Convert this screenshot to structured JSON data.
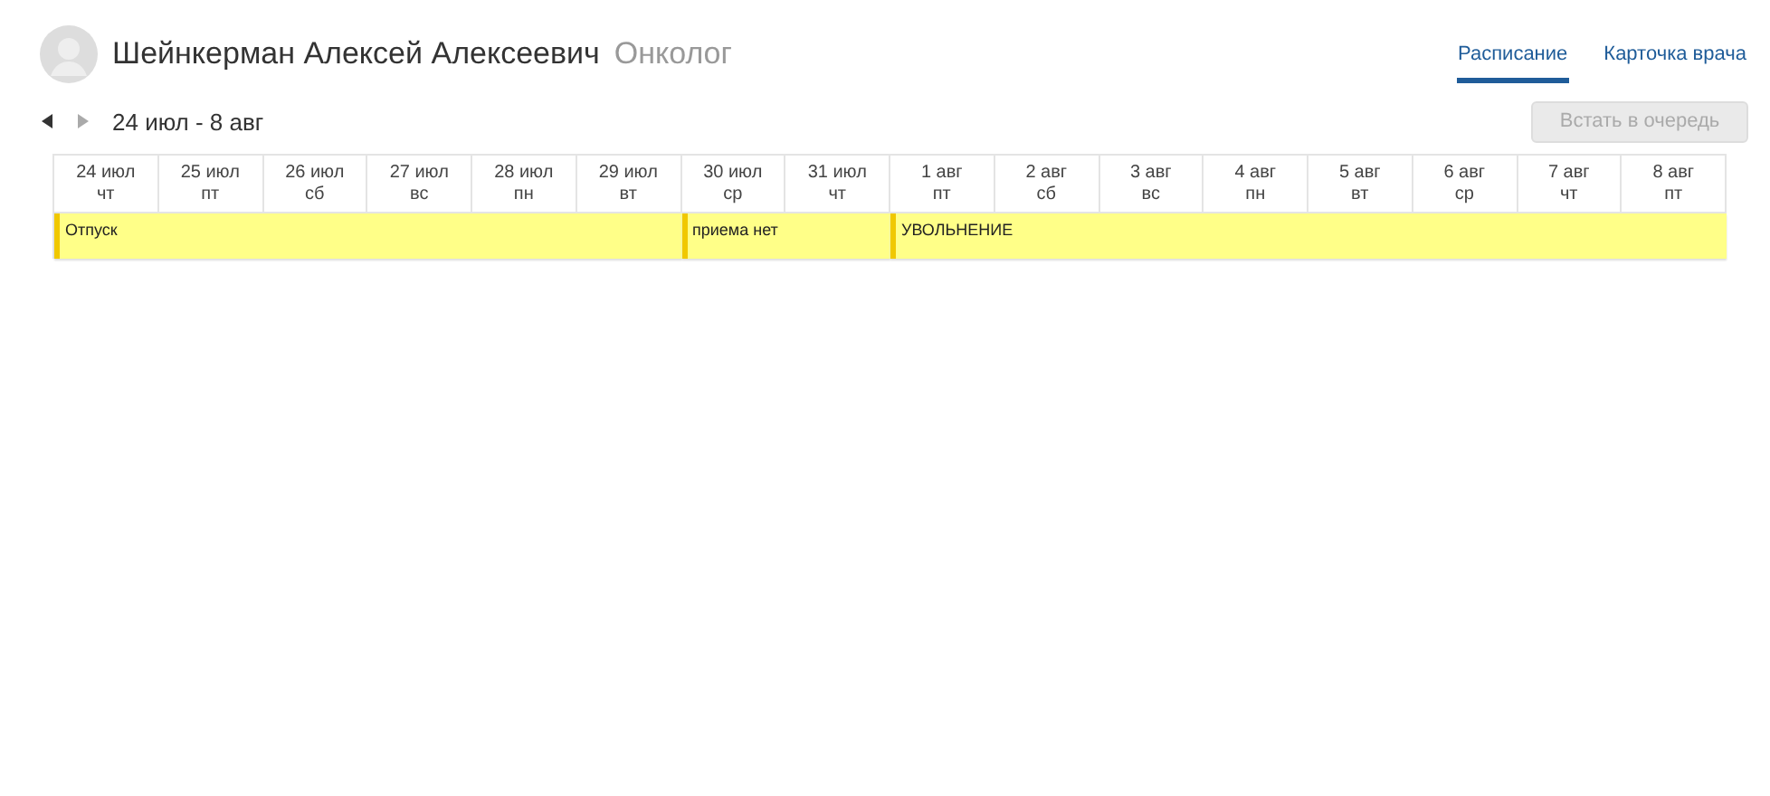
{
  "doctor": {
    "name": "Шейнкерман Алексей Алексеевич",
    "specialty": "Онколог"
  },
  "tabs": [
    {
      "label": "Расписание",
      "selected": true
    },
    {
      "label": "Карточка врача",
      "selected": false
    }
  ],
  "period": "24 июл - 8 авг",
  "queue_button": {
    "label": "Встать в очередь",
    "disabled": true
  },
  "events": [
    {
      "text": "Отпуск",
      "days": [
        {
          "date": "24 июл",
          "weekday": "чт"
        },
        {
          "date": "25 июл",
          "weekday": "пт"
        },
        {
          "date": "26 июл",
          "weekday": "сб"
        },
        {
          "date": "27 июл",
          "weekday": "вс"
        },
        {
          "date": "28 июл",
          "weekday": "пн"
        },
        {
          "date": "29 июл",
          "weekday": "вт"
        }
      ]
    },
    {
      "text": "приема нет",
      "days": [
        {
          "date": "30 июл",
          "weekday": "ср"
        },
        {
          "date": "31 июл",
          "weekday": "чт"
        }
      ]
    },
    {
      "text": "УВОЛЬНЕНИЕ",
      "days": [
        {
          "date": "1 авг",
          "weekday": "пт"
        },
        {
          "date": "2 авг",
          "weekday": "сб"
        },
        {
          "date": "3 авг",
          "weekday": "вс"
        },
        {
          "date": "4 авг",
          "weekday": "пн"
        },
        {
          "date": "5 авг",
          "weekday": "вт"
        },
        {
          "date": "6 авг",
          "weekday": "ср"
        },
        {
          "date": "7 авг",
          "weekday": "чт"
        },
        {
          "date": "8 авг",
          "weekday": "пт"
        }
      ]
    }
  ]
}
